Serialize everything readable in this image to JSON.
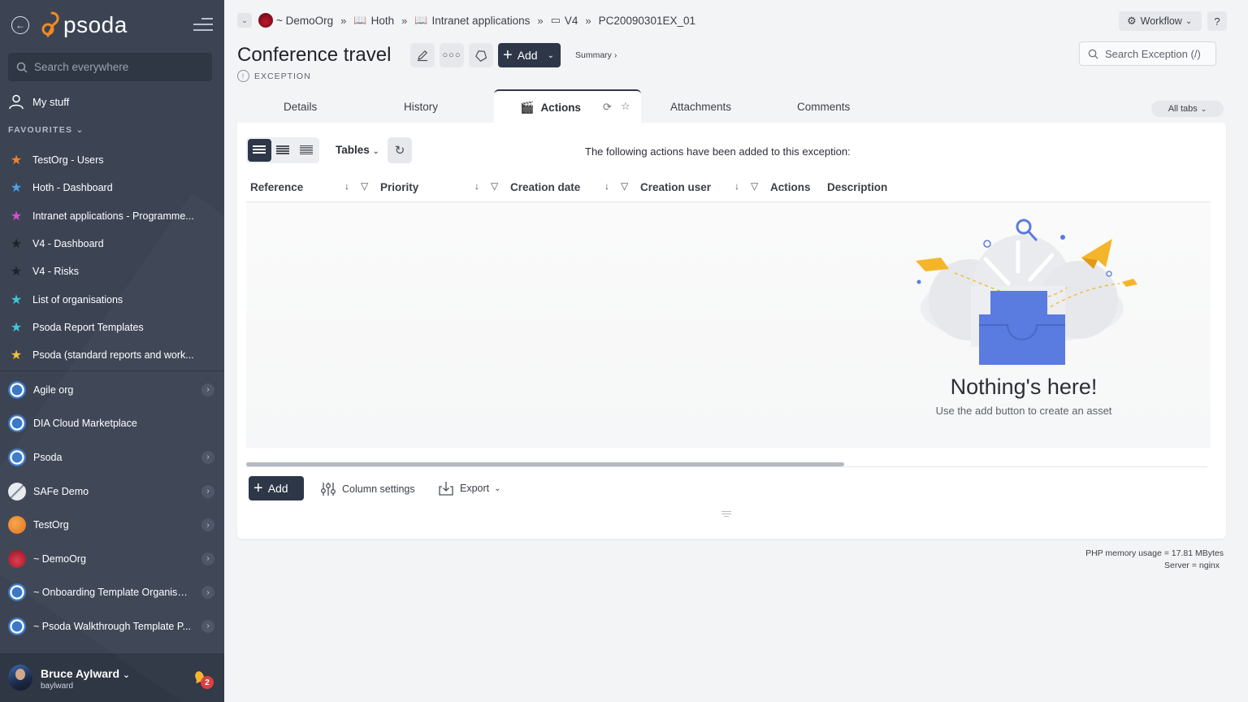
{
  "app": {
    "logo_text": "psoda"
  },
  "sidebar": {
    "search_placeholder": "Search everywhere",
    "my_stuff": "My stuff",
    "favourites_heading": "FAVOURITES",
    "favourites": [
      {
        "label": "TestOrg - Users",
        "star_color": "#f4812a"
      },
      {
        "label": "Hoth - Dashboard",
        "star_color": "#4aa3e8"
      },
      {
        "label": "Intranet applications - Programme...",
        "star_color": "#d64fcf"
      },
      {
        "label": "V4 - Dashboard",
        "star_color": "#1f2329"
      },
      {
        "label": "V4 - Risks",
        "star_color": "#1f2329"
      },
      {
        "label": "List of organisations",
        "star_color": "#3ec6d8"
      },
      {
        "label": "Psoda Report Templates",
        "star_color": "#3ec6d8"
      },
      {
        "label": "Psoda (standard reports and work...",
        "star_color": "#f2c23a"
      }
    ],
    "orgs": [
      {
        "label": "Agile org",
        "icon_color": "#3b79c8",
        "has_children": true
      },
      {
        "label": "DIA Cloud Marketplace",
        "icon_color": "#3b79c8",
        "has_children": false
      },
      {
        "label": "Psoda",
        "icon_color": "#3b79c8",
        "has_children": true
      },
      {
        "label": "SAFe Demo",
        "icon_color": "#d0d4dc",
        "has_children": true
      },
      {
        "label": "TestOrg",
        "icon_color": "#f08a24",
        "has_children": true
      },
      {
        "label": "~ DemoOrg",
        "icon_color": "#c0182b",
        "has_children": true
      },
      {
        "label": "~ Onboarding Template Organisa...",
        "icon_color": "#3b79c8",
        "has_children": true
      },
      {
        "label": "~ Psoda Walkthrough Template P...",
        "icon_color": "#3b79c8",
        "has_children": true
      }
    ],
    "user": {
      "name": "Bruce Aylward",
      "handle": "baylward",
      "notifications": "2"
    }
  },
  "breadcrumb": [
    {
      "label": "~ DemoOrg",
      "icon": "org-logo"
    },
    {
      "label": "Hoth",
      "icon": "book-icon"
    },
    {
      "label": "Intranet applications",
      "icon": "book-icon"
    },
    {
      "label": "V4",
      "icon": "folder-icon"
    },
    {
      "label": "PC20090301EX_01",
      "icon": ""
    }
  ],
  "header": {
    "title": "Conference travel",
    "type": "EXCEPTION",
    "add_label": "Add",
    "summary_label": "Summary ›",
    "workflow_label": "Workflow",
    "help_label": "?",
    "search_label": "Search Exception (/)"
  },
  "tabs": {
    "items": [
      "Details",
      "History",
      "Actions",
      "Attachments",
      "Comments"
    ],
    "active": "Actions",
    "all_tabs": "All tabs"
  },
  "table": {
    "tables_label": "Tables",
    "intro": "The following actions have been added to this exception:",
    "columns": [
      "Reference",
      "Priority",
      "Creation date",
      "Creation user",
      "Actions",
      "Description"
    ],
    "empty_title": "Nothing's here!",
    "empty_subtitle": "Use the add button to create an asset",
    "add_label": "Add",
    "column_settings": "Column settings",
    "export": "Export"
  },
  "footer": {
    "memory": "PHP memory usage = 17.81 MBytes",
    "server": "Server = nginx"
  },
  "colors": {
    "accent": "#2d3748",
    "sidebar": "#3c4454",
    "brand_orange": "#f08a24",
    "illustration_blue": "#5a7be0",
    "illustration_yellow": "#f5b52a"
  }
}
